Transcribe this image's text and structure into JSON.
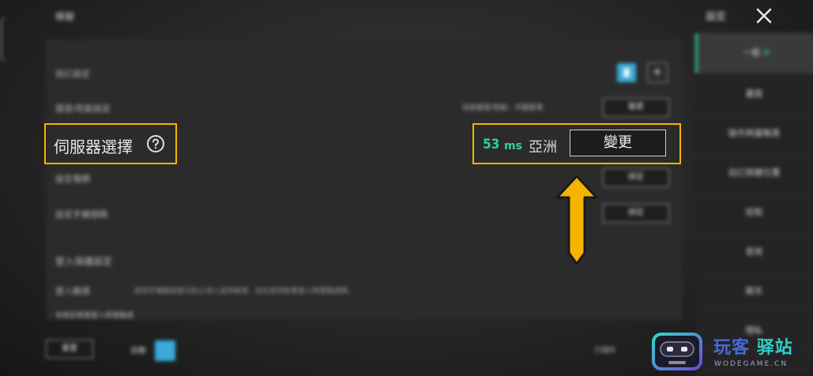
{
  "header": {
    "title": "模擬",
    "settings_label": "設定"
  },
  "rows": [
    {
      "label": "自訂設定"
    },
    {
      "label": "語音/性能設定",
      "hint": "目前語音/性能：中國香港",
      "button": "變更"
    },
    {
      "label": "設定電網",
      "button": "綁定"
    },
    {
      "label": "設定手機號碼",
      "button": "綁定"
    }
  ],
  "section": {
    "title": "登入保護設定",
    "desc_label": "登入驗證",
    "desc": "啟用手機驗證後可防止他人盜用帳號，如在其他裝置登入時需驗證碼。",
    "sub": "非綁定裝置登入時需驗證"
  },
  "server": {
    "label": "伺服器選擇",
    "ping_value": "53",
    "ping_unit": "ms",
    "region": "亞洲",
    "change_button": "變更"
  },
  "sidebar": {
    "items": [
      {
        "label": "一般",
        "badge": "新"
      },
      {
        "label": "畫面"
      },
      {
        "label": "操作與靈敏度"
      },
      {
        "label": "自訂按鍵位置"
      },
      {
        "label": "拾取"
      },
      {
        "label": "音效"
      },
      {
        "label": "聊天"
      },
      {
        "label": "隱私"
      }
    ]
  },
  "bottom": {
    "reset_button": "重置",
    "toggle_label": "自動",
    "right_text": "已儲存"
  },
  "logo": {
    "main_a": "玩客",
    "main_b": "驿站",
    "sub": "WODEGAME.CN"
  },
  "colors": {
    "highlight": "#f5b400",
    "ping": "#2fd0a8",
    "accent_blue": "#3aaad8"
  }
}
